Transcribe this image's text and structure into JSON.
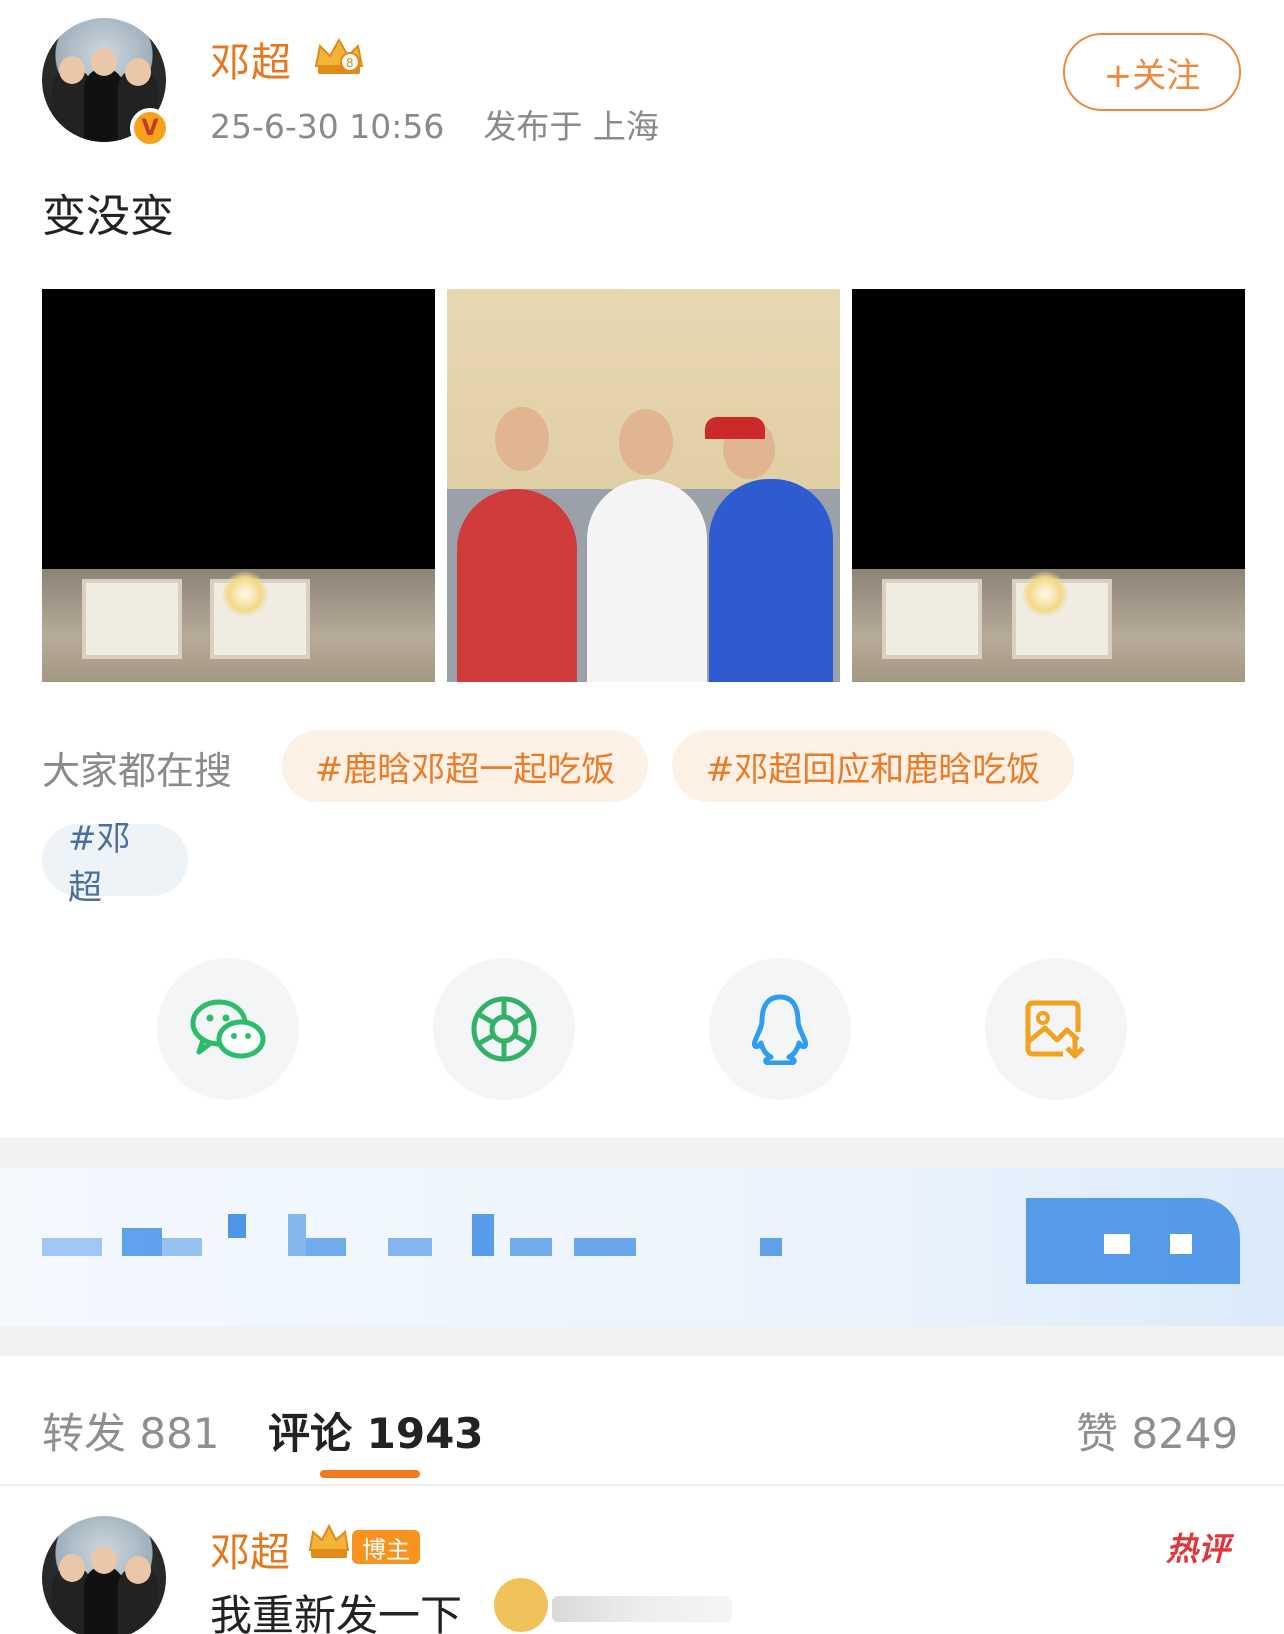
{
  "post": {
    "author": "邓超",
    "time": "25-6-30 10:56",
    "location": "发布于 上海",
    "follow_label": "+关注",
    "text": "变没变"
  },
  "search": {
    "label": "大家都在搜",
    "chips": [
      "#鹿晗邓超一起吃饭",
      "#邓超回应和鹿晗吃饭",
      "#邓超"
    ]
  },
  "share": {
    "icons": [
      "wechat-icon",
      "moments-icon",
      "qq-icon",
      "save-image-icon"
    ],
    "colors": {
      "wechat": "#2bbd6b",
      "moments": "#33b16b",
      "qq": "#2f9cf0",
      "save": "#f3a21f"
    }
  },
  "tabs": {
    "repost": "转发 881",
    "comment": "评论 1943",
    "like": "赞 8249"
  },
  "comment": {
    "author": "邓超",
    "role": "博主",
    "hot": "热评",
    "text": "我重新发一下"
  }
}
